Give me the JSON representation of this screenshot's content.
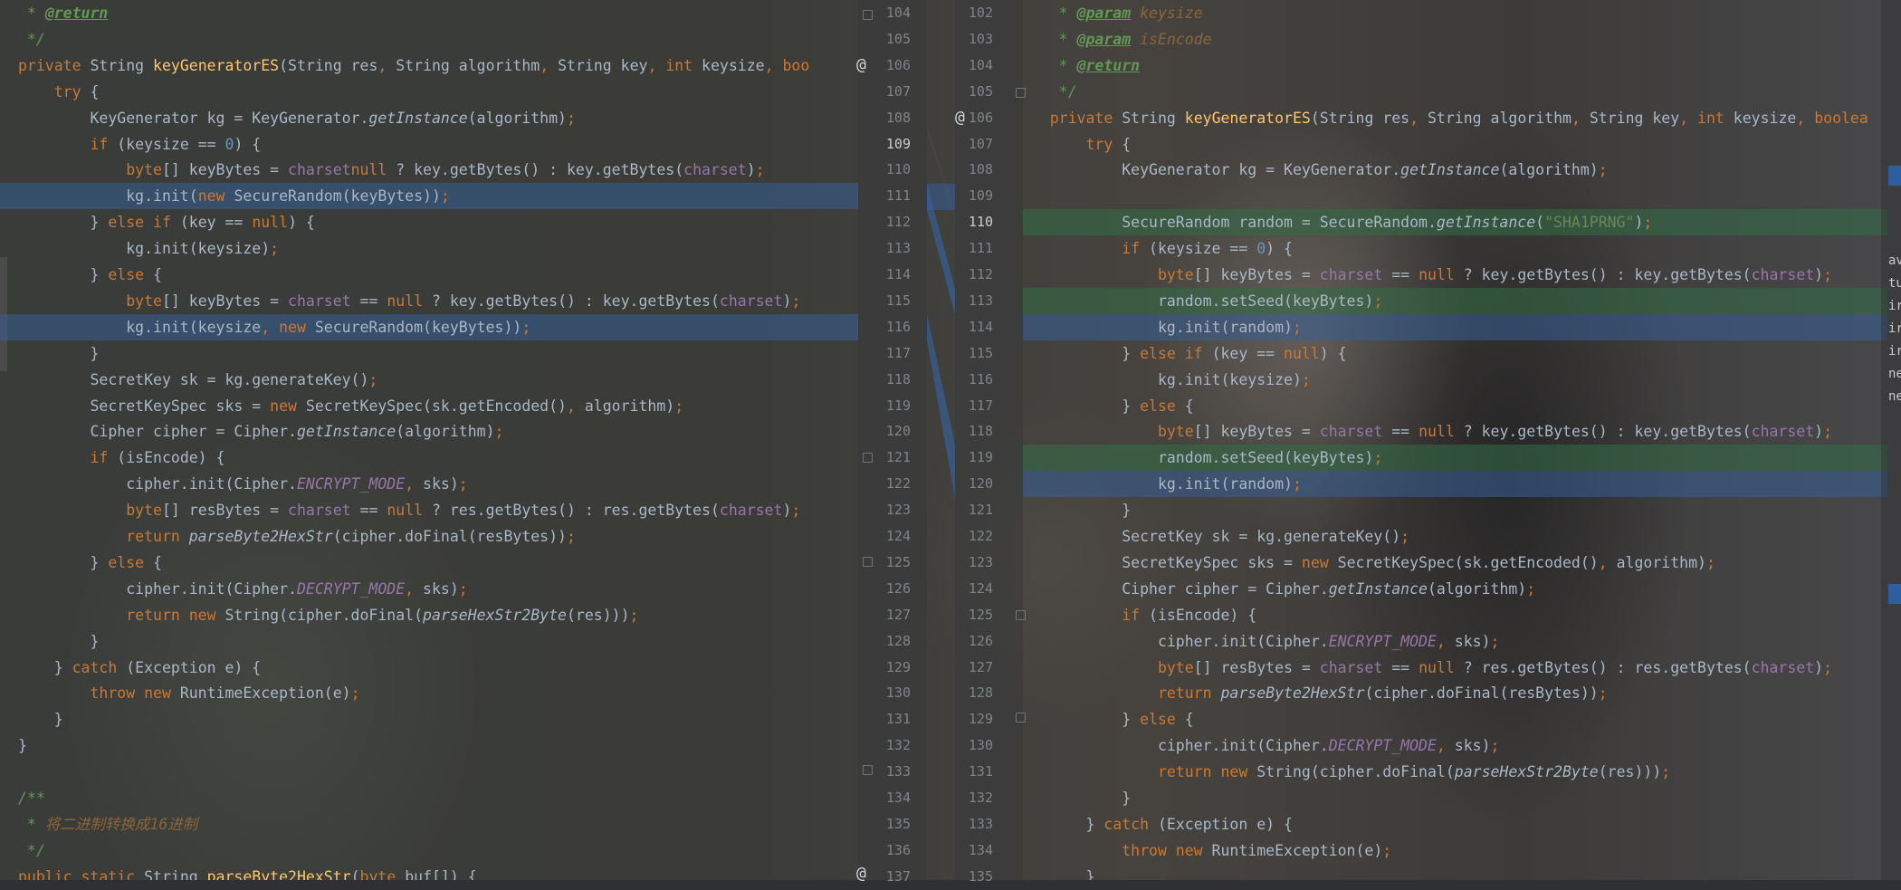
{
  "left_pane": {
    "line_numbers": [
      "104",
      "105",
      "106",
      "107",
      "108",
      "109",
      "110",
      "111",
      "112",
      "113",
      "114",
      "115",
      "116",
      "117",
      "118",
      "119",
      "120",
      "121",
      "122",
      "123",
      "124",
      "125",
      "126",
      "127",
      "128",
      "129",
      "130",
      "131",
      "132",
      "133",
      "134",
      "135",
      "136",
      "137"
    ],
    "lines": [
      [
        [
          "cm",
          " * "
        ],
        [
          "cmt",
          "@return"
        ]
      ],
      [
        [
          "cm",
          " */"
        ]
      ],
      [
        [
          "kw",
          "private "
        ],
        [
          "",
          "String "
        ],
        [
          "fn",
          "keyGeneratorES"
        ],
        [
          "",
          "(String res"
        ],
        [
          "kw",
          ", "
        ],
        [
          "",
          "String algorithm"
        ],
        [
          "kw",
          ", "
        ],
        [
          "",
          "String key"
        ],
        [
          "kw",
          ", int "
        ],
        [
          "",
          "keysize"
        ],
        [
          "kw",
          ", boo"
        ]
      ],
      [
        [
          "kw",
          "    try "
        ],
        [
          "",
          "{"
        ]
      ],
      [
        [
          "",
          "        KeyGenerator kg = KeyGenerator."
        ],
        [
          "it",
          "getInstance"
        ],
        [
          "",
          "(algorithm)"
        ],
        [
          "kw",
          ";"
        ]
      ],
      [
        [
          "kw",
          "        if "
        ],
        [
          "",
          "(keysize == "
        ],
        [
          "num",
          "0"
        ],
        [
          "",
          ") {"
        ]
      ],
      [
        [
          "kw",
          "            byte"
        ],
        [
          "",
          "[] keyBytes = "
        ],
        [
          "pur",
          "charset"
        ],
        [
          "",
          "",
          " == "
        ],
        [
          "kw",
          "null "
        ],
        [
          "",
          "? key.getBytes() : key.getBytes("
        ],
        [
          "pur",
          "charset"
        ],
        [
          "",
          ")"
        ],
        [
          "kw",
          ";"
        ]
      ],
      [
        [
          "",
          "            kg.init("
        ],
        [
          "kw",
          "new "
        ],
        [
          "",
          "SecureRandom(keyBytes))"
        ],
        [
          "kw",
          ";"
        ]
      ],
      [
        [
          "",
          "        } "
        ],
        [
          "kw",
          "else if "
        ],
        [
          "",
          "(key == "
        ],
        [
          "kw",
          "null"
        ],
        [
          "",
          ") {"
        ]
      ],
      [
        [
          "",
          "            kg.init(keysize)"
        ],
        [
          "kw",
          ";"
        ]
      ],
      [
        [
          "",
          "        } "
        ],
        [
          "kw",
          "else "
        ],
        [
          "",
          "{"
        ]
      ],
      [
        [
          "kw",
          "            byte"
        ],
        [
          "",
          "[] keyBytes = "
        ],
        [
          "pur",
          "charset"
        ],
        [
          "",
          " == "
        ],
        [
          "kw",
          "null "
        ],
        [
          "",
          "? key.getBytes() : key.getBytes("
        ],
        [
          "pur",
          "charset"
        ],
        [
          "",
          ")"
        ],
        [
          "kw",
          ";"
        ]
      ],
      [
        [
          "",
          "            kg.init(keysize"
        ],
        [
          "kw",
          ", new "
        ],
        [
          "",
          "SecureRandom(keyBytes))"
        ],
        [
          "kw",
          ";"
        ]
      ],
      [
        [
          "",
          "        }"
        ]
      ],
      [
        [
          "",
          "        SecretKey sk = kg.generateKey()"
        ],
        [
          "kw",
          ";"
        ]
      ],
      [
        [
          "",
          "        SecretKeySpec sks = "
        ],
        [
          "kw",
          "new "
        ],
        [
          "",
          "SecretKeySpec(sk.getEncoded()"
        ],
        [
          "kw",
          ", "
        ],
        [
          "",
          "algorithm)"
        ],
        [
          "kw",
          ";"
        ]
      ],
      [
        [
          "",
          "        Cipher cipher = Cipher."
        ],
        [
          "it",
          "getInstance"
        ],
        [
          "",
          "(algorithm)"
        ],
        [
          "kw",
          ";"
        ]
      ],
      [
        [
          "kw",
          "        if "
        ],
        [
          "",
          "(isEncode) {"
        ]
      ],
      [
        [
          "",
          "            cipher.init(Cipher."
        ],
        [
          "const",
          "ENCRYPT_MODE"
        ],
        [
          "kw",
          ", "
        ],
        [
          "",
          "sks)"
        ],
        [
          "kw",
          ";"
        ]
      ],
      [
        [
          "kw",
          "            byte"
        ],
        [
          "",
          "[] resBytes = "
        ],
        [
          "pur",
          "charset"
        ],
        [
          "",
          " == "
        ],
        [
          "kw",
          "null "
        ],
        [
          "",
          "? res.getBytes() : res.getBytes("
        ],
        [
          "pur",
          "charset"
        ],
        [
          "",
          ")"
        ],
        [
          "kw",
          ";"
        ]
      ],
      [
        [
          "kw",
          "            return "
        ],
        [
          "it",
          "parseByte2HexStr"
        ],
        [
          "",
          "(cipher.doFinal(resBytes))"
        ],
        [
          "kw",
          ";"
        ]
      ],
      [
        [
          "",
          "        } "
        ],
        [
          "kw",
          "else "
        ],
        [
          "",
          "{"
        ]
      ],
      [
        [
          "",
          "            cipher.init(Cipher."
        ],
        [
          "const",
          "DECRYPT_MODE"
        ],
        [
          "kw",
          ", "
        ],
        [
          "",
          "sks)"
        ],
        [
          "kw",
          ";"
        ]
      ],
      [
        [
          "kw",
          "            return new "
        ],
        [
          "",
          "String(cipher.doFinal("
        ],
        [
          "it",
          "parseHexStr2Byte"
        ],
        [
          "",
          "(res)))"
        ],
        [
          "kw",
          ";"
        ]
      ],
      [
        [
          "",
          "        }"
        ]
      ],
      [
        [
          "",
          "    } "
        ],
        [
          "kw",
          "catch "
        ],
        [
          "",
          "(Exception e) {"
        ]
      ],
      [
        [
          "kw",
          "        throw new "
        ],
        [
          "",
          "RuntimeException(e)"
        ],
        [
          "kw",
          ";"
        ]
      ],
      [
        [
          "",
          "    }"
        ]
      ],
      [
        [
          "",
          "}"
        ]
      ],
      [
        [
          "",
          ""
        ]
      ],
      [
        [
          "cm",
          "/**"
        ]
      ],
      [
        [
          "cm",
          " * "
        ],
        [
          "cmv",
          "将二进制转换成16进制"
        ]
      ],
      [
        [
          "cm",
          " */"
        ]
      ],
      [
        [
          "kw",
          "public static "
        ],
        [
          "",
          "String "
        ],
        [
          "fn",
          "parseByte2HexStr"
        ],
        [
          "",
          "("
        ],
        [
          "kw",
          "byte "
        ],
        [
          "",
          "buf[]) {"
        ]
      ]
    ]
  },
  "right_pane": {
    "line_numbers": [
      "102",
      "103",
      "104",
      "105",
      "106",
      "107",
      "108",
      "109",
      "110",
      "111",
      "112",
      "113",
      "114",
      "115",
      "116",
      "117",
      "118",
      "119",
      "120",
      "121",
      "122",
      "123",
      "124",
      "125",
      "126",
      "127",
      "128",
      "129",
      "130",
      "131",
      "132",
      "133",
      "134",
      "135"
    ],
    "lines": [
      [
        [
          "cm",
          "     * "
        ],
        [
          "cmt",
          "@param"
        ],
        [
          "cmv",
          " keysize"
        ]
      ],
      [
        [
          "cm",
          "     * "
        ],
        [
          "cmt",
          "@param"
        ],
        [
          "cmv",
          " isEncode"
        ]
      ],
      [
        [
          "cm",
          "     * "
        ],
        [
          "cmt",
          "@return"
        ]
      ],
      [
        [
          "cm",
          "     */"
        ]
      ],
      [
        [
          "kw",
          "    private "
        ],
        [
          "",
          "String "
        ],
        [
          "fn",
          "keyGeneratorES"
        ],
        [
          "",
          "(String res"
        ],
        [
          "kw",
          ", "
        ],
        [
          "",
          "String algorithm"
        ],
        [
          "kw",
          ", "
        ],
        [
          "",
          "String key"
        ],
        [
          "kw",
          ", int "
        ],
        [
          "",
          "keysize"
        ],
        [
          "kw",
          ", boolea"
        ]
      ],
      [
        [
          "kw",
          "        try "
        ],
        [
          "",
          "{"
        ]
      ],
      [
        [
          "",
          "            KeyGenerator kg = KeyGenerator."
        ],
        [
          "it",
          "getInstance"
        ],
        [
          "",
          "(algorithm)"
        ],
        [
          "kw",
          ";"
        ]
      ],
      [
        [
          "",
          ""
        ]
      ],
      [
        [
          "",
          "            SecureRandom random = SecureRandom."
        ],
        [
          "it",
          "getInstance"
        ],
        [
          "",
          "("
        ],
        [
          "str",
          "\"SHA1PRNG\""
        ],
        [
          "",
          ")"
        ],
        [
          "kw",
          ";"
        ]
      ],
      [
        [
          "kw",
          "            if "
        ],
        [
          "",
          "(keysize == "
        ],
        [
          "num",
          "0"
        ],
        [
          "",
          ") {"
        ]
      ],
      [
        [
          "kw",
          "                byte"
        ],
        [
          "",
          "[] keyBytes = "
        ],
        [
          "pur",
          "charset"
        ],
        [
          "",
          " == "
        ],
        [
          "kw",
          "null "
        ],
        [
          "",
          "? key.getBytes() : key.getBytes("
        ],
        [
          "pur",
          "charset"
        ],
        [
          "",
          ")"
        ],
        [
          "kw",
          ";"
        ]
      ],
      [
        [
          "",
          "                random.setSeed(keyBytes)"
        ],
        [
          "kw",
          ";"
        ]
      ],
      [
        [
          "",
          "                kg.init(random)"
        ],
        [
          "kw",
          ";"
        ]
      ],
      [
        [
          "",
          "            } "
        ],
        [
          "kw",
          "else if "
        ],
        [
          "",
          "(key == "
        ],
        [
          "kw",
          "null"
        ],
        [
          "",
          ") {"
        ]
      ],
      [
        [
          "",
          "                kg.init(keysize)"
        ],
        [
          "kw",
          ";"
        ]
      ],
      [
        [
          "",
          "            } "
        ],
        [
          "kw",
          "else "
        ],
        [
          "",
          "{"
        ]
      ],
      [
        [
          "kw",
          "                byte"
        ],
        [
          "",
          "[] keyBytes = "
        ],
        [
          "pur",
          "charset"
        ],
        [
          "",
          " == "
        ],
        [
          "kw",
          "null "
        ],
        [
          "",
          "? key.getBytes() : key.getBytes("
        ],
        [
          "pur",
          "charset"
        ],
        [
          "",
          ")"
        ],
        [
          "kw",
          ";"
        ]
      ],
      [
        [
          "",
          "                random.setSeed(keyBytes)"
        ],
        [
          "kw",
          ";"
        ]
      ],
      [
        [
          "",
          "                kg.init(random)"
        ],
        [
          "kw",
          ";"
        ]
      ],
      [
        [
          "",
          "            }"
        ]
      ],
      [
        [
          "",
          "            SecretKey sk = kg.generateKey()"
        ],
        [
          "kw",
          ";"
        ]
      ],
      [
        [
          "",
          "            SecretKeySpec sks = "
        ],
        [
          "kw",
          "new "
        ],
        [
          "",
          "SecretKeySpec(sk.getEncoded()"
        ],
        [
          "kw",
          ", "
        ],
        [
          "",
          "algorithm)"
        ],
        [
          "kw",
          ";"
        ]
      ],
      [
        [
          "",
          "            Cipher cipher = Cipher."
        ],
        [
          "it",
          "getInstance"
        ],
        [
          "",
          "(algorithm)"
        ],
        [
          "kw",
          ";"
        ]
      ],
      [
        [
          "kw",
          "            if "
        ],
        [
          "",
          "(isEncode) {"
        ]
      ],
      [
        [
          "",
          "                cipher.init(Cipher."
        ],
        [
          "const",
          "ENCRYPT_MODE"
        ],
        [
          "kw",
          ", "
        ],
        [
          "",
          "sks)"
        ],
        [
          "kw",
          ";"
        ]
      ],
      [
        [
          "kw",
          "                byte"
        ],
        [
          "",
          "[] resBytes = "
        ],
        [
          "pur",
          "charset"
        ],
        [
          "",
          " == "
        ],
        [
          "kw",
          "null "
        ],
        [
          "",
          "? res.getBytes() : res.getBytes("
        ],
        [
          "pur",
          "charset"
        ],
        [
          "",
          ")"
        ],
        [
          "kw",
          ";"
        ]
      ],
      [
        [
          "kw",
          "                return "
        ],
        [
          "it",
          "parseByte2HexStr"
        ],
        [
          "",
          "(cipher.doFinal(resBytes))"
        ],
        [
          "kw",
          ";"
        ]
      ],
      [
        [
          "",
          "            } "
        ],
        [
          "kw",
          "else "
        ],
        [
          "",
          "{"
        ]
      ],
      [
        [
          "",
          "                cipher.init(Cipher."
        ],
        [
          "const",
          "DECRYPT_MODE"
        ],
        [
          "kw",
          ", "
        ],
        [
          "",
          "sks)"
        ],
        [
          "kw",
          ";"
        ]
      ],
      [
        [
          "kw",
          "                return new "
        ],
        [
          "",
          "String(cipher.doFinal("
        ],
        [
          "it",
          "parseHexStr2Byte"
        ],
        [
          "",
          "(res)))"
        ],
        [
          "kw",
          ";"
        ]
      ],
      [
        [
          "",
          "            }"
        ]
      ],
      [
        [
          "",
          "        } "
        ],
        [
          "kw",
          "catch "
        ],
        [
          "",
          "(Exception e) {"
        ]
      ],
      [
        [
          "kw",
          "            throw new "
        ],
        [
          "",
          "RuntimeException(e)"
        ],
        [
          "kw",
          ";"
        ]
      ],
      [
        [
          "",
          "        }"
        ]
      ]
    ]
  },
  "markers": {
    "override_symbol": "@"
  },
  "right_edge_glyphs": [
    "av",
    "tu",
    "ire",
    "ire",
    "ire",
    "ne",
    "ne"
  ],
  "colors": {
    "keyword": "#cc7832",
    "method": "#ffc66d",
    "comment": "#629755",
    "field": "#9876aa",
    "number": "#6897bb",
    "string": "#6a8759",
    "modified": "#375f96",
    "added": "#326e46"
  }
}
